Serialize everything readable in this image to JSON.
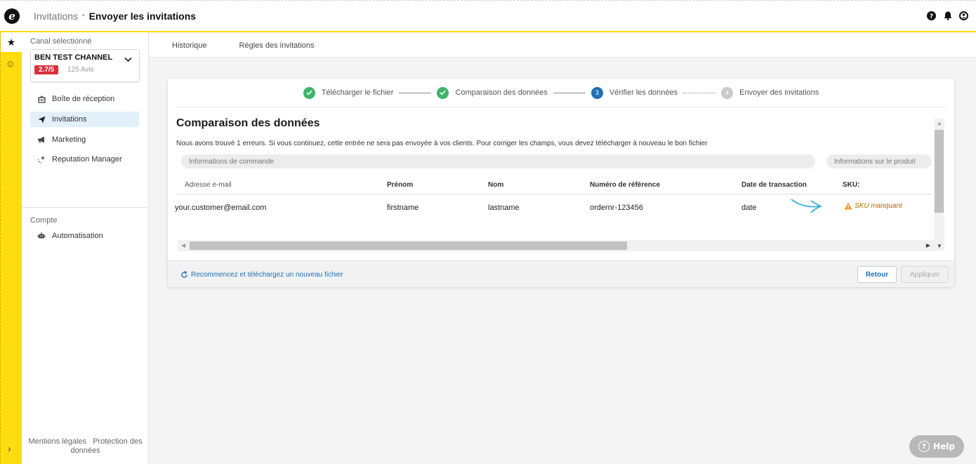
{
  "header": {
    "logo_letter": "e",
    "breadcrumb_root": "Invitations",
    "breadcrumb_sep": "•",
    "breadcrumb_current": "Envoyer les invitations",
    "icons": [
      "help-icon",
      "bell-icon",
      "user-icon"
    ]
  },
  "rail": {
    "star": "★",
    "gear": "⚙",
    "expand": "›"
  },
  "sidebar": {
    "channel_label": "Canal sélectionné",
    "channel_name": "BEN TEST CHANNEL",
    "rating": "2.7/5",
    "review_count": "125 Avis",
    "items": [
      {
        "label": "Boîte de réception",
        "icon": "inbox-icon"
      },
      {
        "label": "Invitations",
        "icon": "send-icon"
      },
      {
        "label": "Marketing",
        "icon": "megaphone-icon"
      },
      {
        "label": "Reputation Manager",
        "icon": "sparkle-icon"
      }
    ],
    "account_label": "Compte",
    "account_items": [
      {
        "label": "Automatisation",
        "icon": "robot-icon"
      }
    ],
    "footer_legal": "Mentions légales",
    "footer_privacy": "Protection des données"
  },
  "subnav": {
    "tabs": [
      "Historique",
      "Règles des invitations"
    ]
  },
  "stepper": {
    "steps": [
      {
        "label": "Télécharger le fichier",
        "state": "done"
      },
      {
        "label": "Comparaison des données",
        "state": "done"
      },
      {
        "number": "3",
        "label": "Vérifier les données",
        "state": "current"
      },
      {
        "number": "4",
        "label": "Envoyer des invitations",
        "state": "pending"
      }
    ]
  },
  "main": {
    "title": "Comparaison des données",
    "description": "Nous avons trouvé 1 erreurs. Si vous continuez, cette entrée ne sera pas envoyée à vos clients. Pour corriger les champs, vous devez télécharger à nouveau le bon fichier",
    "group_order": "Informations de commande",
    "group_product": "Informations sur le produit",
    "columns": [
      "Adresse e-mail",
      "Prénom",
      "Nom",
      "Numéro de référence",
      "Date de transaction",
      "SKU:"
    ],
    "row": {
      "email": "your.customer@email.com",
      "firstname": "firstname",
      "lastname": "lastname",
      "reference": "ordernr-123456",
      "date": "date",
      "sku_error": "SKU manquant"
    },
    "restart_link": "Recommencez et téléchargez un nouveau fichier",
    "back_button": "Retour",
    "apply_button": "Appliquer"
  },
  "help": {
    "label": "Help"
  },
  "colors": {
    "brand_yellow": "#ffdc0f",
    "link_blue": "#1f6fb5",
    "success_green": "#3fb36b",
    "error_red": "#d9303b",
    "arrow_blue": "#3aaee0"
  }
}
